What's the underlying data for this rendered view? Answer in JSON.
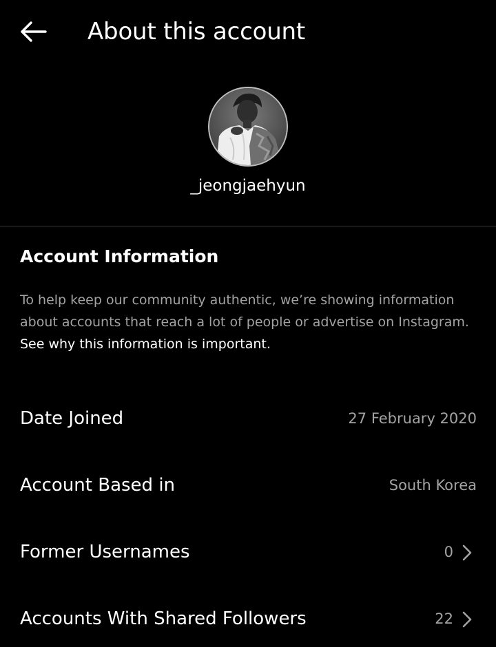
{
  "header": {
    "title": "About this account",
    "back_icon": "arrow-left-icon"
  },
  "profile": {
    "username": "_jeongjaehyun",
    "avatar_icon": "profile-photo"
  },
  "account_information": {
    "title": "Account Information",
    "description": "To help keep our community authentic, we’re showing information about accounts that reach a lot of people or advertise on Instagram. ",
    "link_text": "See why this information is important."
  },
  "rows": [
    {
      "label": "Date Joined",
      "value": "27 February 2020"
    },
    {
      "label": "Account Based in",
      "value": "South Korea"
    },
    {
      "label": "Former Usernames",
      "value": "0",
      "chevron_icon": "chevron-right-icon"
    },
    {
      "label": "Accounts With Shared Followers",
      "value": "22",
      "chevron_icon": "chevron-right-icon"
    }
  ],
  "colors": {
    "background": "#000000",
    "text_primary": "#ffffff",
    "text_secondary": "#a3a3a3",
    "divider": "#3a3a3a"
  }
}
